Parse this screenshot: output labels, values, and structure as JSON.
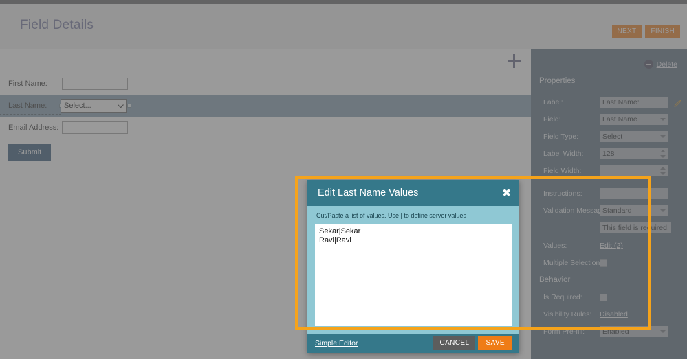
{
  "header": {
    "title": "Field Details",
    "buttons": [
      {
        "label": "NEXT",
        "name": "next-button"
      },
      {
        "label": "FINISH",
        "name": "finish-button"
      }
    ]
  },
  "canvas": {
    "add_icon": "plus-icon",
    "form": {
      "rows": [
        {
          "label": "First Name:",
          "type": "text",
          "value": ""
        },
        {
          "label": "Last Name:",
          "type": "select",
          "value": "Select...",
          "selected": true
        },
        {
          "label": "Email Address:",
          "type": "text",
          "value": ""
        }
      ],
      "submit_label": "Submit"
    }
  },
  "properties_panel": {
    "delete_label": "Delete",
    "delete_icon": "minus-circle-icon",
    "sections": {
      "properties_heading": "Properties",
      "behavior_heading": "Behavior"
    },
    "rows": [
      {
        "label": "Label:",
        "value": "Last Name:",
        "control": "text",
        "icon": "pencil-icon"
      },
      {
        "label": "Field:",
        "value": "Last Name",
        "control": "select"
      },
      {
        "label": "Field Type:",
        "value": "Select",
        "control": "select"
      },
      {
        "label": "Label Width:",
        "value": "128",
        "control": "spinner"
      },
      {
        "label": "Field Width:",
        "value": "",
        "control": "spinner"
      },
      {
        "label": "Instructions:",
        "value": "",
        "control": "text"
      },
      {
        "label": "Validation Message:",
        "value": "Standard",
        "control": "select"
      },
      {
        "label": "",
        "value": "This field is required.",
        "control": "text"
      },
      {
        "label": "Values:",
        "value": "Edit (2)",
        "control": "link"
      },
      {
        "label": "Multiple Selections:",
        "value": "",
        "control": "checkbox"
      }
    ],
    "behavior_rows": [
      {
        "label": "Is Required:",
        "value": "",
        "control": "checkbox"
      },
      {
        "label": "Visibility Rules:",
        "value": "Disabled",
        "control": "link"
      },
      {
        "label": "Form Pre-fill:",
        "value": "Enabled",
        "control": "select"
      }
    ]
  },
  "modal": {
    "title": "Edit Last Name Values",
    "close_icon": "close-icon",
    "hint": "Cut/Paste a list of values. Use | to define server values",
    "textarea_value": "Sekar|Sekar\nRavi|Ravi",
    "textarea_placeholder": "",
    "simple_editor_label": "Simple Editor",
    "cancel_label": "CANCEL",
    "save_label": "SAVE"
  },
  "annotation": {
    "color": "#f5a31b",
    "shape": "rectangle-highlight"
  },
  "colors": {
    "accent_orange": "#ef7c16",
    "modal_header_teal": "#35788a",
    "modal_body_teal": "#8fc8d4",
    "panel_slate": "#67798a",
    "submit_blue": "#3f6182",
    "selected_row": "#8ca4b5",
    "title_purple": "#7b7fa6"
  }
}
